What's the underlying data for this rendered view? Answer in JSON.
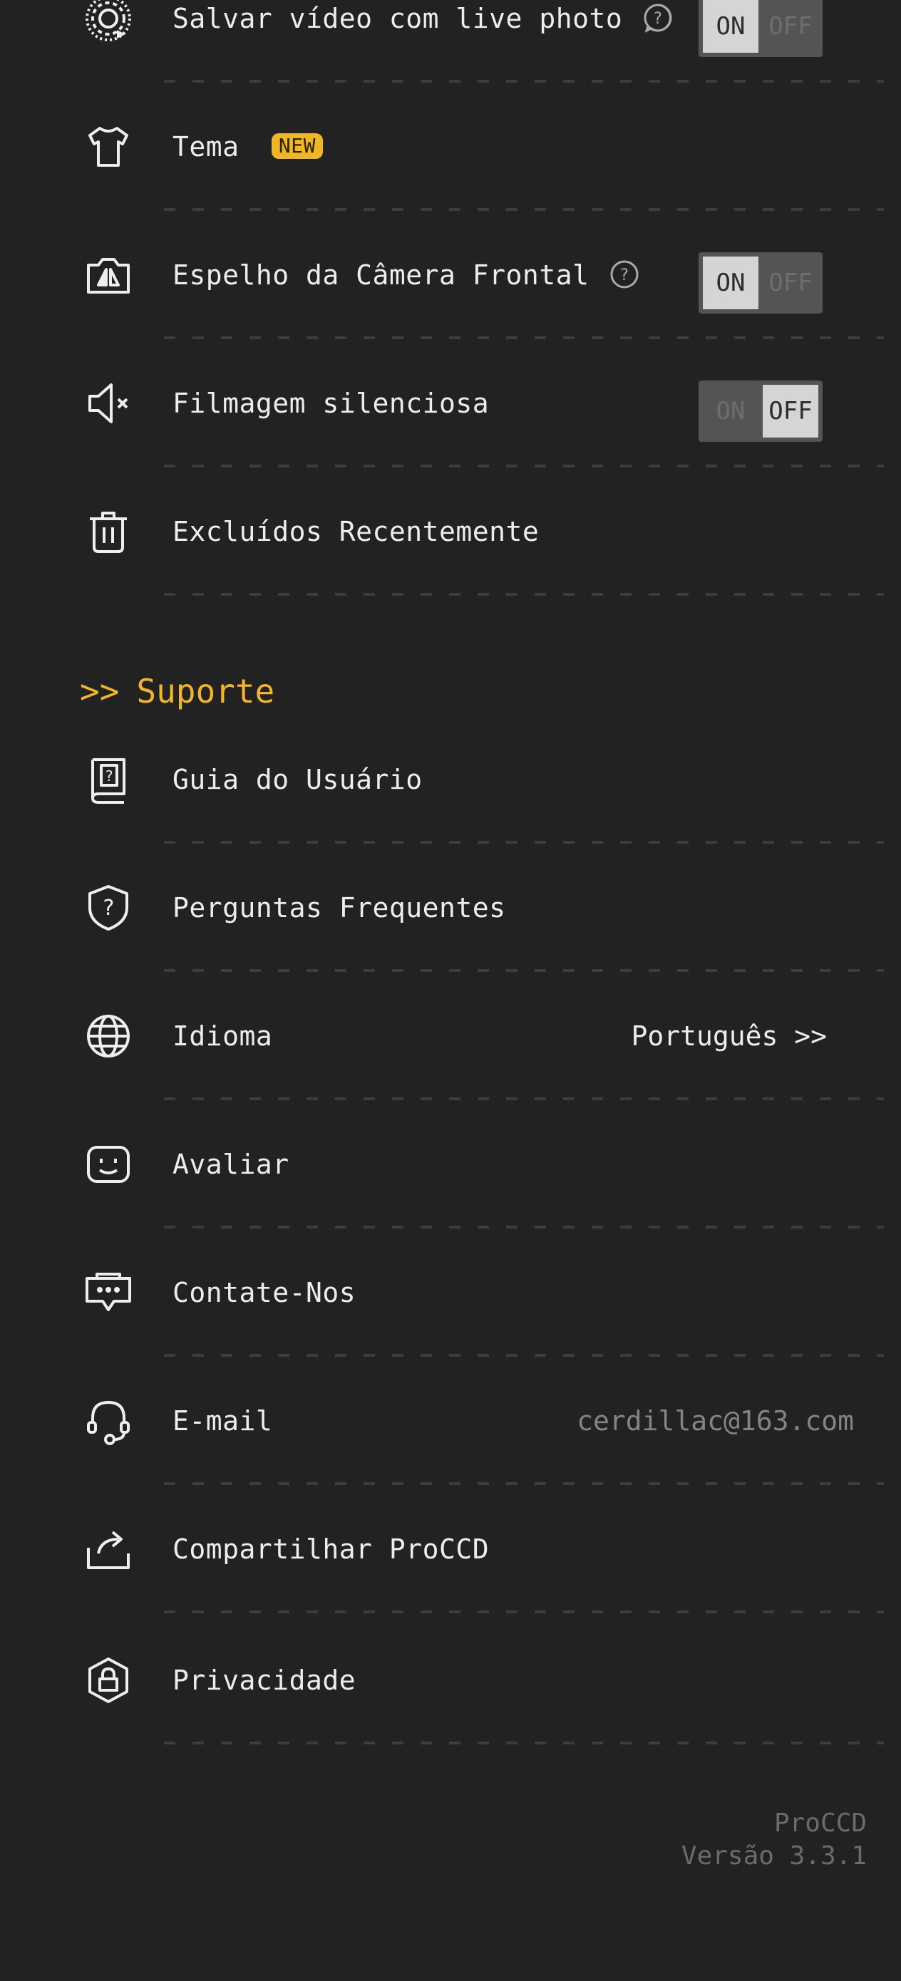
{
  "settings": {
    "items": [
      {
        "label": "Salvar vídeo com live photo",
        "toggle": {
          "on": "ON",
          "off": "OFF",
          "state": "on"
        }
      },
      {
        "label": "Tema",
        "badge": "NEW"
      },
      {
        "label": "Espelho da Câmera Frontal",
        "toggle": {
          "on": "ON",
          "off": "OFF",
          "state": "on"
        }
      },
      {
        "label": "Filmagem silenciosa",
        "toggle": {
          "on": "ON",
          "off": "OFF",
          "state": "off"
        }
      },
      {
        "label": "Excluídos Recentemente"
      }
    ]
  },
  "support": {
    "header": "Suporte",
    "header_chevron": ">>",
    "items": [
      {
        "label": "Guia do Usuário"
      },
      {
        "label": "Perguntas Frequentes"
      },
      {
        "label": "Idioma",
        "value": "Português >>"
      },
      {
        "label": "Avaliar"
      },
      {
        "label": "Contate-Nos"
      },
      {
        "label": "E-mail",
        "value": "cerdillac@163.com"
      },
      {
        "label": "Compartilhar ProCCD"
      },
      {
        "label": "Privacidade"
      }
    ]
  },
  "footer": {
    "app_name": "ProCCD",
    "version": "Versão 3.3.1"
  },
  "colors": {
    "background": "#232223",
    "accent": "#F2B42A",
    "text": "#ECECEC",
    "muted": "#6C6B6C"
  }
}
